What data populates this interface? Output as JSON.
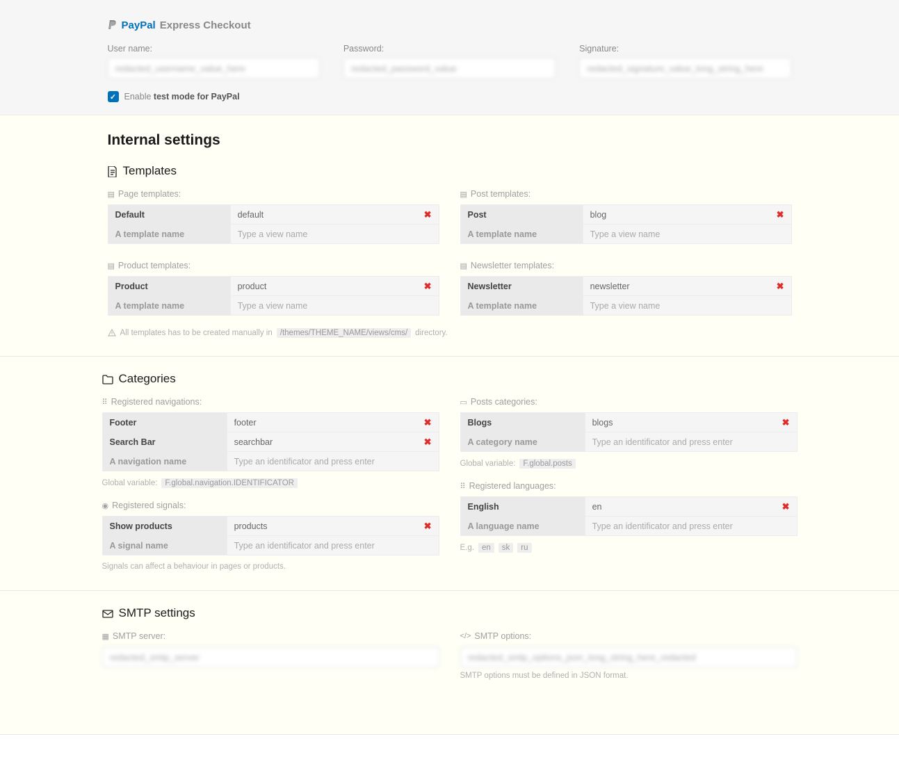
{
  "paypal": {
    "brand": "PayPal",
    "subtitle": "Express Checkout",
    "username_label": "User name:",
    "password_label": "Password:",
    "signature_label": "Signature:",
    "username_value": "redacted_username_value_here",
    "password_value": "redacted_password_value",
    "signature_value": "redacted_signature_value_long_string_here",
    "enable_prefix": "Enable ",
    "enable_bold": "test mode for PayPal"
  },
  "internal_title": "Internal settings",
  "templates": {
    "section_title": "Templates",
    "page_label": "Page templates:",
    "post_label": "Post templates:",
    "product_label": "Product templates:",
    "newsletter_label": "Newsletter templates:",
    "page": {
      "name": "Default",
      "value": "default"
    },
    "post": {
      "name": "Post",
      "value": "blog"
    },
    "product": {
      "name": "Product",
      "value": "product"
    },
    "newsletter": {
      "name": "Newsletter",
      "value": "newsletter"
    },
    "name_placeholder": "A template name",
    "value_placeholder": "Type a view name",
    "note_prefix": "All templates has to be created manually in",
    "note_code": "/themes/THEME_NAME/views/cms/",
    "note_suffix": "directory."
  },
  "categories": {
    "section_title": "Categories",
    "nav_label": "Registered navigations:",
    "posts_label": "Posts categories:",
    "signals_label": "Registered signals:",
    "langs_label": "Registered languages:",
    "nav": [
      {
        "name": "Footer",
        "value": "footer"
      },
      {
        "name": "Search Bar",
        "value": "searchbar"
      }
    ],
    "nav_name_ph": "A navigation name",
    "ident_ph": "Type an identificator and press enter",
    "nav_note_prefix": "Global variable:",
    "nav_note_code": "F.global.navigation.IDENTIFICATOR",
    "posts": [
      {
        "name": "Blogs",
        "value": "blogs"
      }
    ],
    "posts_name_ph": "A category name",
    "posts_note_prefix": "Global variable:",
    "posts_note_code": "F.global.posts",
    "signals": [
      {
        "name": "Show products",
        "value": "products"
      }
    ],
    "signals_name_ph": "A signal name",
    "signals_note": "Signals can affect a behaviour in pages or products.",
    "langs": [
      {
        "name": "English",
        "value": "en"
      }
    ],
    "langs_name_ph": "A language name",
    "langs_note_prefix": "E.g.",
    "langs_examples": [
      "en",
      "sk",
      "ru"
    ]
  },
  "smtp": {
    "section_title": "SMTP settings",
    "server_label": "SMTP server:",
    "options_label": "SMTP options:",
    "server_value": "redacted_smtp_server",
    "options_value": "redacted_smtp_options_json_long_string_here_redacted",
    "options_note": "SMTP options must be defined in JSON format."
  }
}
